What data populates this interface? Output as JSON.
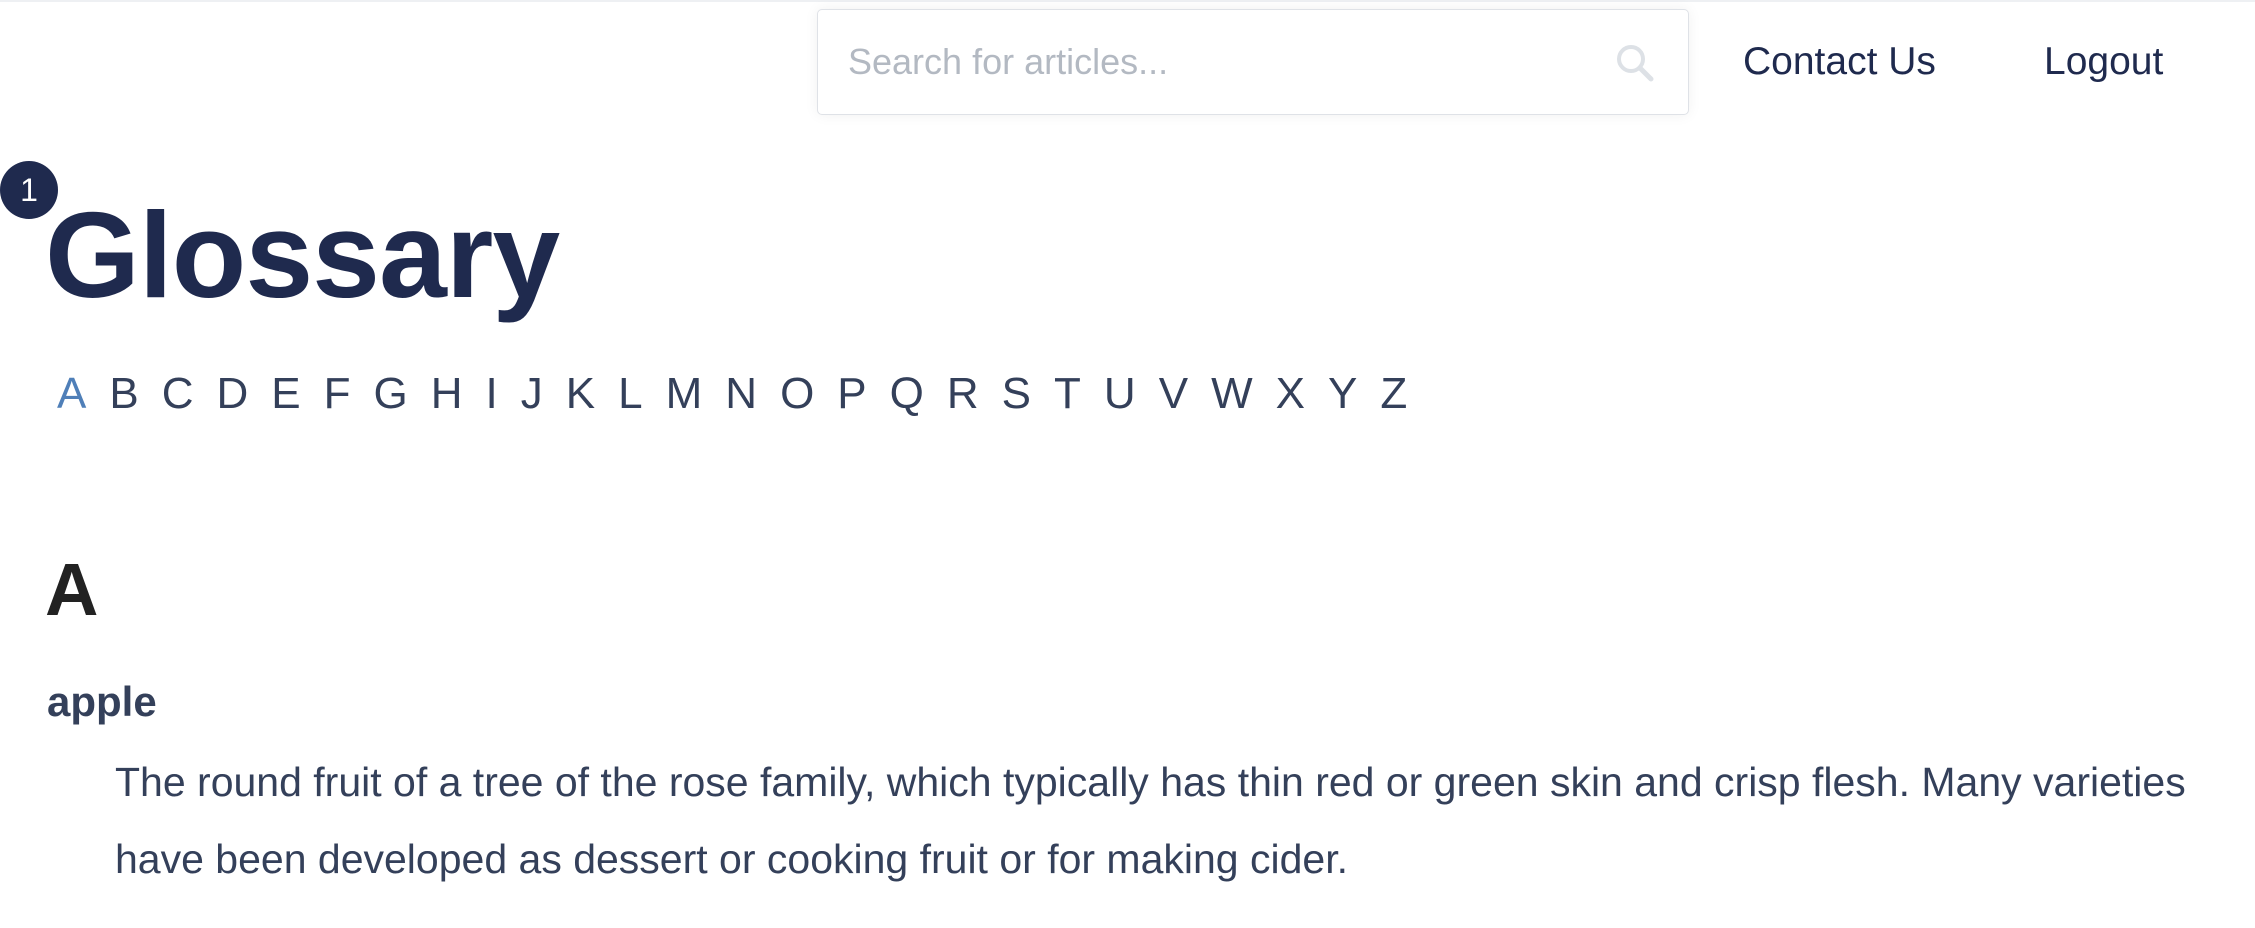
{
  "header": {
    "search": {
      "placeholder": "Search for articles...",
      "value": "",
      "icon": "search-icon"
    },
    "nav": [
      {
        "label": "Contact Us"
      },
      {
        "label": "Logout"
      }
    ]
  },
  "step_badge": "1",
  "page": {
    "title": "Glossary"
  },
  "alphabet": {
    "letters": [
      "A",
      "B",
      "C",
      "D",
      "E",
      "F",
      "G",
      "H",
      "I",
      "J",
      "K",
      "L",
      "M",
      "N",
      "O",
      "P",
      "Q",
      "R",
      "S",
      "T",
      "U",
      "V",
      "W",
      "X",
      "Y",
      "Z"
    ],
    "active": "A"
  },
  "sections": [
    {
      "heading": "A",
      "entries": [
        {
          "term": "apple",
          "definition": "The round fruit of a tree of the rose family, which typically has thin red or green skin and crisp flesh. Many varieties have been developed as dessert or cooking fruit or for making cider."
        }
      ]
    }
  ],
  "colors": {
    "brand_dark": "#1f2a4e",
    "text": "#34405a",
    "active_letter": "#4f7fb8",
    "placeholder": "#b3b9c2"
  }
}
